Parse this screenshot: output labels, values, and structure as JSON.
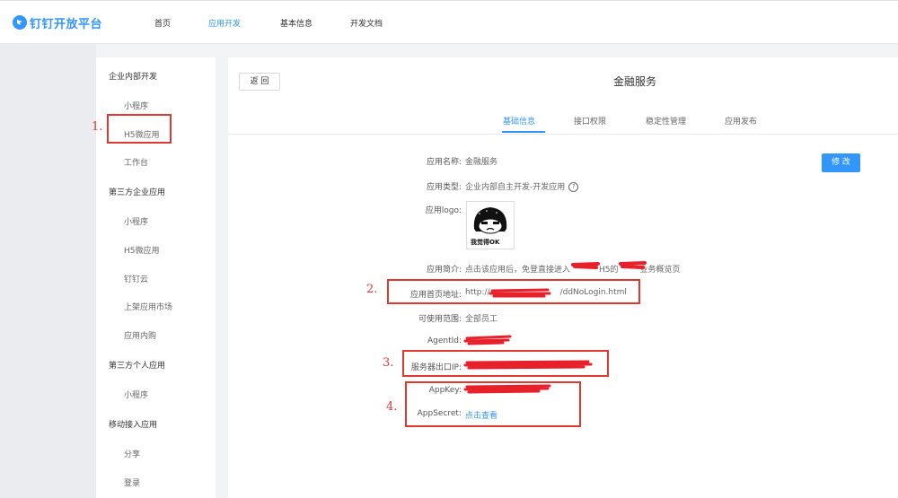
{
  "brand": {
    "name": "钉钉开放平台",
    "icon": "dingtalk-logo-icon",
    "color": "#3296fa"
  },
  "nav": [
    "首页",
    "应用开发",
    "基本信息",
    "开发文档"
  ],
  "nav_active": "应用开发",
  "sidebar": [
    "企业内部开发",
    "小程序",
    "H5微应用",
    "工作台",
    "第三方企业应用",
    "小程序",
    "H5微应用",
    "钉钉云",
    "上架应用市场",
    "应用内购",
    "第三方个人应用",
    "小程序",
    "移动接入应用",
    "分享",
    "登录"
  ],
  "back_label": "返 回",
  "title": "金融服务",
  "tabs": [
    "基础信息",
    "接口权限",
    "稳定性管理",
    "应用发布"
  ],
  "active_tab": "基础信息",
  "edit_label": "修 改",
  "fields": [
    {
      "label": "应用名称:",
      "value": "金融服务"
    },
    {
      "label": "应用类型:",
      "value": "企业内部自主开发-开发应用"
    },
    {
      "label": "应用logo:",
      "value": ""
    },
    {
      "label": "应用简介:",
      "value_prefix": "点击该应用后，免登直接进入",
      "value_mid": "H5的",
      "value_suffix": "业务概览页"
    },
    {
      "label": "应用首页地址:",
      "value_prefix": "http://",
      "value_suffix": "/ddNoLogin.html"
    },
    {
      "label": "可使用范围:",
      "value": "全部员工"
    },
    {
      "label": "AgentId:",
      "value": ""
    },
    {
      "label": "服务器出口IP:",
      "value": ""
    },
    {
      "label": "AppKey:",
      "value": ""
    },
    {
      "label": "AppSecret:",
      "value": "点击查看"
    }
  ],
  "logo_caption": "我觉得OK",
  "help_icon": "question-circle-icon",
  "annotations": [
    "1.",
    "2.",
    "3.",
    "4."
  ],
  "colors": {
    "accent": "#3296fa",
    "annotation": "#e0392f"
  }
}
